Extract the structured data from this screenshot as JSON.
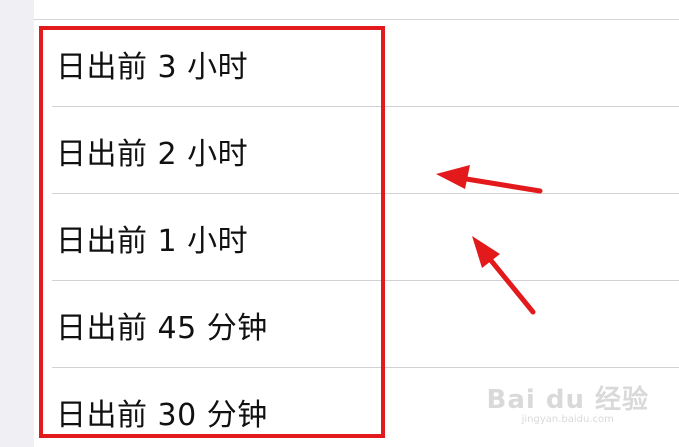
{
  "options": [
    {
      "label": "日出前 3 小时"
    },
    {
      "label": "日出前 2 小时"
    },
    {
      "label": "日出前 1 小时"
    },
    {
      "label": "日出前 45 分钟"
    },
    {
      "label": "日出前 30 分钟"
    }
  ],
  "annotation": {
    "box_color": "#e31a1c",
    "arrow_color": "#e31a1c"
  },
  "watermark": {
    "main": "Bai du 经验",
    "sub": "jingyan.baidu.com"
  },
  "colors": {
    "background": "#efeff4",
    "list_background": "#ffffff",
    "separator": "#d2d2d6",
    "text": "#111111"
  }
}
